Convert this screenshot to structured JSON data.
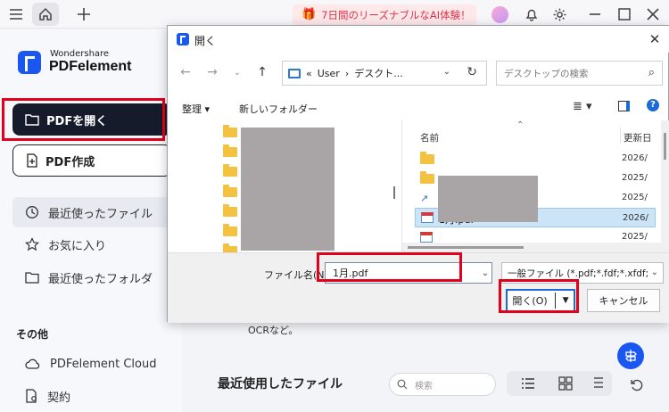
{
  "topbar": {
    "promo_text": "7日間のリーズナブルなAI体験！"
  },
  "sidebar": {
    "logo_brand": "Wondershare",
    "logo_product": "PDFelement",
    "open_pdf_label": "PDFを開く",
    "create_pdf_label": "PDF作成",
    "nav": [
      {
        "label": "最近使ったファイル",
        "icon": "clock-icon"
      },
      {
        "label": "お気に入り",
        "icon": "star-icon"
      },
      {
        "label": "最近使ったフォルダ",
        "icon": "folder-icon"
      }
    ],
    "other_title": "その他",
    "other": [
      {
        "label": "PDFelement Cloud",
        "icon": "cloud-icon"
      },
      {
        "label": "契約",
        "icon": "contract-icon"
      }
    ]
  },
  "main": {
    "ocr_text": "OCRなど。",
    "recent_title": "最近使用したファイル",
    "search_placeholder": "検索"
  },
  "dialog": {
    "title": "開く",
    "address": {
      "prefix": "«",
      "segment1": "User",
      "sep": "›",
      "segment2": "デスクト..."
    },
    "search_placeholder": "デスクトップの検索",
    "organize_label": "整理 ▾",
    "new_folder_label": "新しいフォルダー",
    "columns": {
      "name": "名前",
      "date": "更新日"
    },
    "rows": [
      {
        "name": "",
        "date": "2026/",
        "type": "folder",
        "selected": false
      },
      {
        "name": "",
        "date": "2025/",
        "type": "folder",
        "selected": false
      },
      {
        "name": "",
        "date": "2025/",
        "type": "shortcut",
        "selected": false
      },
      {
        "name": "1月.pdf",
        "date": "2026/",
        "type": "pdf",
        "selected": true
      },
      {
        "name": "",
        "date": "2025/",
        "type": "pdf",
        "selected": false
      }
    ],
    "filename_label": "ファイル名(N):",
    "filename_value": "1月.pdf",
    "filter_value": "一般ファイル (*.pdf;*.fdf;*.xfdf;",
    "open_button": "開く(O)",
    "cancel_button": "キャンセル"
  },
  "colors": {
    "accent": "#1a57f0",
    "highlight": "#e2001a",
    "selection": "#cce4f7"
  }
}
